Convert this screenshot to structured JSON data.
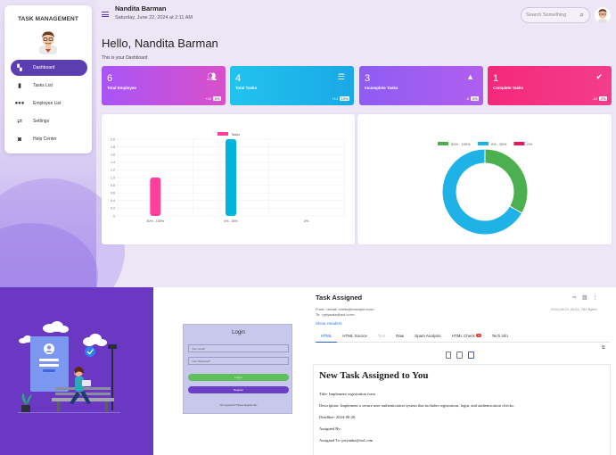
{
  "sidebar": {
    "title": "TASK MANAGEMENT",
    "items": [
      {
        "label": "Dashboard",
        "icon": "dashboard-icon"
      },
      {
        "label": "Tasks List",
        "icon": "document-icon"
      },
      {
        "label": "Employee List",
        "icon": "people-icon"
      },
      {
        "label": "Settings",
        "icon": "sliders-icon"
      },
      {
        "label": "Help Center",
        "icon": "help-icon"
      }
    ]
  },
  "header": {
    "user_name": "Nandita Barman",
    "date": "Saturday, June 22, 2024 at 2:11 AM",
    "search_placeholder": "Search Something"
  },
  "main": {
    "greeting": "Hello, Nandita Barman",
    "subtitle": "This is your Dashboard"
  },
  "stat_cards": [
    {
      "value": "6",
      "label": "Total Employee",
      "change": "+12",
      "percent": "5%",
      "icon": "people-icon",
      "color": "#c052e0"
    },
    {
      "value": "4",
      "label": "Total Tasks",
      "change": "+14",
      "percent": "10%",
      "icon": "list-icon",
      "color": "#1fb6ea"
    },
    {
      "value": "3",
      "label": "Incomplete Tasks",
      "change": "-8",
      "percent": "5%",
      "icon": "warning-icon",
      "color": "#9c5df1"
    },
    {
      "value": "1",
      "label": "Complete Tasks",
      "change": "-12",
      "percent": "2%",
      "icon": "check-circle-icon",
      "color": "#f42e82"
    }
  ],
  "chart_data": [
    {
      "type": "bar",
      "legend": [
        "Tasks"
      ],
      "categories": [
        "50% - 100%",
        "0% - 50%",
        "0%"
      ],
      "series": [
        {
          "name": "Tasks",
          "values": [
            1,
            2,
            0
          ]
        }
      ],
      "ylim": [
        0,
        2
      ],
      "yticks": [
        "0",
        "0.2",
        "0.4",
        "0.6",
        "0.8",
        "1.0",
        "1.2",
        "1.4",
        "1.6",
        "1.8",
        "2.0"
      ],
      "colors": [
        "#ff3e9d",
        "#00b4dc"
      ]
    },
    {
      "type": "pie",
      "legend": [
        "50% - 100%",
        "0% - 50%",
        "0%"
      ],
      "values": [
        1,
        2,
        0
      ],
      "colors": [
        "#4caf50",
        "#1eb2e6",
        "#e8175d"
      ]
    }
  ],
  "login": {
    "title": "Login",
    "email_placeholder": "Your email*",
    "password_placeholder": "Your Password*",
    "login_label": "Log in",
    "register_label": "Register",
    "footer": "Not registered? Please Register first"
  },
  "email": {
    "subject": "Task Assigned",
    "from": "From: <email: chiefs@example.com>",
    "to": "To: <priyanka@aol.com>",
    "meta": "2024-06-21 20:41, 763 Bytes",
    "show_headers": "Show Headers",
    "tabs": [
      {
        "label": "HTML"
      },
      {
        "label": "HTML Source"
      },
      {
        "label": "Text"
      },
      {
        "label": "Raw"
      },
      {
        "label": "Spam Analysis"
      },
      {
        "label": "HTML Check",
        "badge": "3"
      },
      {
        "label": "Tech Info"
      }
    ],
    "heading": "New Task Assigned to You",
    "lines": [
      "Title: Implement registration form",
      "Description: Implement a secure user authentication system that includes registration, login, and authentication checks.",
      "Deadline: 2024-06-26",
      "Assigned By:",
      "Assigned To: priyanka@aol.com"
    ]
  }
}
